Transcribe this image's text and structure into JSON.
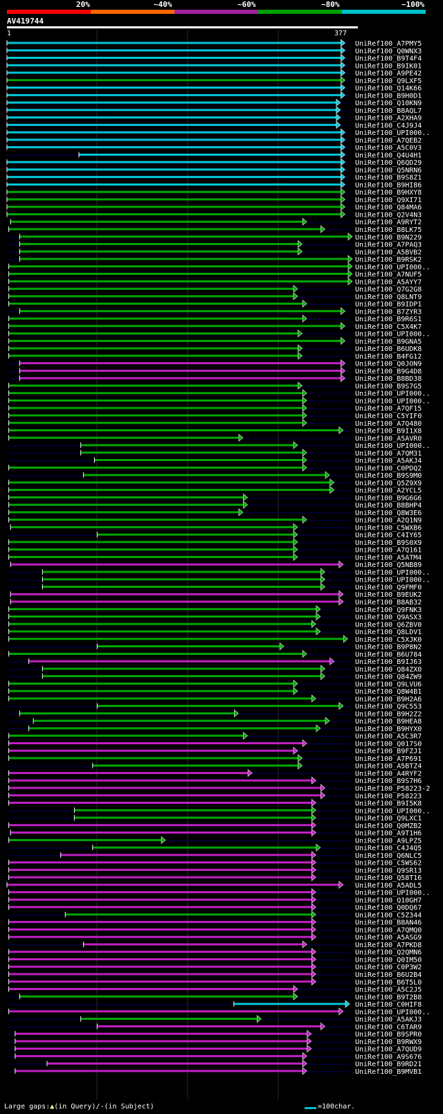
{
  "legend": [
    {
      "label": "20%",
      "color": "#ff0000"
    },
    {
      "label": "~40%",
      "color": "#ff6600"
    },
    {
      "label": "~60%",
      "color": "#a020a0"
    },
    {
      "label": "~80%",
      "color": "#00a000"
    },
    {
      "label": "~100%",
      "color": "#00c0c8"
    }
  ],
  "query_title": "AV419744",
  "query_length": 377,
  "ruler_start": "1",
  "ruler_end": "377",
  "footer": {
    "large_gaps": "Large gaps:",
    "in_query": "(in Query)/-",
    "in_subject": "(in Subject)",
    "scale_label": "=100char."
  },
  "hits": [
    {
      "name": "UniRef100_A7PMY5",
      "color": "cyan",
      "start": 1,
      "end": 372
    },
    {
      "name": "UniRef100_Q0WNX3",
      "color": "cyan",
      "start": 1,
      "end": 372
    },
    {
      "name": "UniRef100_B9T4F4",
      "color": "cyan",
      "start": 1,
      "end": 372
    },
    {
      "name": "UniRef100_B9IK01",
      "color": "cyan",
      "start": 1,
      "end": 372
    },
    {
      "name": "UniRef100_A9PE42",
      "color": "cyan",
      "start": 1,
      "end": 372
    },
    {
      "name": "UniRef100_Q9LXF5",
      "color": "green",
      "start": 1,
      "end": 372
    },
    {
      "name": "UniRef100_Q14K66",
      "color": "cyan",
      "start": 1,
      "end": 372
    },
    {
      "name": "UniRef100_B9H0D1",
      "color": "cyan",
      "start": 1,
      "end": 372
    },
    {
      "name": "UniRef100_Q10KN9",
      "color": "cyan",
      "start": 1,
      "end": 367
    },
    {
      "name": "UniRef100_B8AQL7",
      "color": "cyan",
      "start": 1,
      "end": 367
    },
    {
      "name": "UniRef100_A2XHA9",
      "color": "cyan",
      "start": 1,
      "end": 367
    },
    {
      "name": "UniRef100_C4J9J4",
      "color": "cyan",
      "start": 1,
      "end": 367
    },
    {
      "name": "UniRef100_UPI000..",
      "color": "cyan",
      "start": 1,
      "end": 372
    },
    {
      "name": "UniRef100_A7QEB2",
      "color": "cyan",
      "start": 1,
      "end": 372
    },
    {
      "name": "UniRef100_A5C0V3",
      "color": "cyan",
      "start": 1,
      "end": 372
    },
    {
      "name": "UniRef100_Q4U4H1",
      "color": "cyan",
      "start": 80,
      "end": 372
    },
    {
      "name": "UniRef100_Q6QD29",
      "color": "cyan",
      "start": 1,
      "end": 372
    },
    {
      "name": "UniRef100_Q5NRN6",
      "color": "cyan",
      "start": 1,
      "end": 372
    },
    {
      "name": "UniRef100_B9S8Z1",
      "color": "cyan",
      "start": 1,
      "end": 372
    },
    {
      "name": "UniRef100_B9HI86",
      "color": "cyan",
      "start": 1,
      "end": 372
    },
    {
      "name": "UniRef100_B9HXY8",
      "color": "green",
      "start": 1,
      "end": 372
    },
    {
      "name": "UniRef100_Q9XI71",
      "color": "green",
      "start": 1,
      "end": 372
    },
    {
      "name": "UniRef100_Q84MA6",
      "color": "green",
      "start": 1,
      "end": 372
    },
    {
      "name": "UniRef100_Q2V4N3",
      "color": "green",
      "start": 1,
      "end": 372
    },
    {
      "name": "UniRef100_A9RYT2",
      "color": "green",
      "start": 5,
      "end": 330
    },
    {
      "name": "UniRef100_B8LK75",
      "color": "green",
      "start": 3,
      "end": 350
    },
    {
      "name": "UniRef100_B9N229",
      "color": "green",
      "start": 15,
      "end": 380
    },
    {
      "name": "UniRef100_A7PAQ3",
      "color": "green",
      "start": 15,
      "end": 325
    },
    {
      "name": "UniRef100_A5BVB2",
      "color": "green",
      "start": 15,
      "end": 325
    },
    {
      "name": "UniRef100_B9RSK2",
      "color": "green",
      "start": 15,
      "end": 380
    },
    {
      "name": "UniRef100_UPI000..",
      "color": "green",
      "start": 3,
      "end": 380
    },
    {
      "name": "UniRef100_A7NUF5",
      "color": "green",
      "start": 3,
      "end": 380
    },
    {
      "name": "UniRef100_A5AYY7",
      "color": "green",
      "start": 3,
      "end": 380
    },
    {
      "name": "UniRef100_Q7G2G8",
      "color": "green",
      "start": 3,
      "end": 320
    },
    {
      "name": "UniRef100_Q8LNT9",
      "color": "green",
      "start": 3,
      "end": 320
    },
    {
      "name": "UniRef100_B9IDP1",
      "color": "green",
      "start": 3,
      "end": 330
    },
    {
      "name": "UniRef100_B7ZYR3",
      "color": "green",
      "start": 15,
      "end": 372
    },
    {
      "name": "UniRef100_B9R6S1",
      "color": "green",
      "start": 3,
      "end": 330
    },
    {
      "name": "UniRef100_C5X4K7",
      "color": "green",
      "start": 3,
      "end": 372
    },
    {
      "name": "UniRef100_UPI000..",
      "color": "green",
      "start": 3,
      "end": 325
    },
    {
      "name": "UniRef100_B9GNA5",
      "color": "green",
      "start": 3,
      "end": 372
    },
    {
      "name": "UniRef100_B6UDK8",
      "color": "green",
      "start": 3,
      "end": 325
    },
    {
      "name": "UniRef100_B4FG12",
      "color": "green",
      "start": 3,
      "end": 325
    },
    {
      "name": "UniRef100_Q0JON9",
      "color": "purple",
      "start": 15,
      "end": 372
    },
    {
      "name": "UniRef100_B9G4D8",
      "color": "purple",
      "start": 15,
      "end": 372
    },
    {
      "name": "UniRef100_B8BD38",
      "color": "purple",
      "start": 15,
      "end": 372
    },
    {
      "name": "UniRef100_B9S7G5",
      "color": "green",
      "start": 3,
      "end": 325
    },
    {
      "name": "UniRef100_UPI000..",
      "color": "green",
      "start": 3,
      "end": 330
    },
    {
      "name": "UniRef100_UPI000..",
      "color": "green",
      "start": 3,
      "end": 330
    },
    {
      "name": "UniRef100_A7QF15",
      "color": "green",
      "start": 3,
      "end": 330
    },
    {
      "name": "UniRef100_C5YIF0",
      "color": "green",
      "start": 3,
      "end": 330
    },
    {
      "name": "UniRef100_A7Q480",
      "color": "green",
      "start": 3,
      "end": 330
    },
    {
      "name": "UniRef100_B9I1X8",
      "color": "green",
      "start": 3,
      "end": 370
    },
    {
      "name": "UniRef100_A5AVR0",
      "color": "green",
      "start": 3,
      "end": 260
    },
    {
      "name": "UniRef100_UPI000..",
      "color": "green",
      "start": 82,
      "end": 320
    },
    {
      "name": "UniRef100_A7QM31",
      "color": "green",
      "start": 82,
      "end": 330
    },
    {
      "name": "UniRef100_A5AKJ4",
      "color": "green",
      "start": 97,
      "end": 330
    },
    {
      "name": "UniRef100_C0PDQ2",
      "color": "green",
      "start": 3,
      "end": 330
    },
    {
      "name": "UniRef100_B9S9M0",
      "color": "green",
      "start": 85,
      "end": 355
    },
    {
      "name": "UniRef100_Q5Z9X9",
      "color": "green",
      "start": 3,
      "end": 360
    },
    {
      "name": "UniRef100_A2YCL5",
      "color": "green",
      "start": 3,
      "end": 360
    },
    {
      "name": "UniRef100_B9G6G6",
      "color": "green",
      "start": 3,
      "end": 265
    },
    {
      "name": "UniRef100_B8BHP4",
      "color": "green",
      "start": 3,
      "end": 265
    },
    {
      "name": "UniRef100_Q8W3E6",
      "color": "green",
      "start": 3,
      "end": 260
    },
    {
      "name": "UniRef100_A2Q1N9",
      "color": "green",
      "start": 3,
      "end": 330
    },
    {
      "name": "UniRef100_C5WXB6",
      "color": "green",
      "start": 5,
      "end": 320
    },
    {
      "name": "UniRef100_C4IY65",
      "color": "green",
      "start": 100,
      "end": 320
    },
    {
      "name": "UniRef100_B9S0X9",
      "color": "green",
      "start": 3,
      "end": 320
    },
    {
      "name": "UniRef100_A7Q161",
      "color": "green",
      "start": 3,
      "end": 320
    },
    {
      "name": "UniRef100_A5ATM4",
      "color": "green",
      "start": 3,
      "end": 320
    },
    {
      "name": "UniRef100_Q5NB89",
      "color": "purple",
      "start": 5,
      "end": 370
    },
    {
      "name": "UniRef100_UPI000..",
      "color": "green",
      "start": 40,
      "end": 350
    },
    {
      "name": "UniRef100_UPI000..",
      "color": "green",
      "start": 40,
      "end": 350
    },
    {
      "name": "UniRef100_Q9FMF0",
      "color": "green",
      "start": 40,
      "end": 350
    },
    {
      "name": "UniRef100_B9EUK2",
      "color": "purple",
      "start": 5,
      "end": 370
    },
    {
      "name": "UniRef100_B8AB32",
      "color": "purple",
      "start": 5,
      "end": 370
    },
    {
      "name": "UniRef100_Q9FNK3",
      "color": "green",
      "start": 3,
      "end": 345
    },
    {
      "name": "UniRef100_Q9ASX3",
      "color": "green",
      "start": 3,
      "end": 345
    },
    {
      "name": "UniRef100_Q6ZBV0",
      "color": "green",
      "start": 3,
      "end": 340
    },
    {
      "name": "UniRef100_Q8LDV1",
      "color": "green",
      "start": 3,
      "end": 345
    },
    {
      "name": "UniRef100_C5XJK0",
      "color": "green",
      "start": 3,
      "end": 375
    },
    {
      "name": "UniRef100_B9P8N2",
      "color": "green",
      "start": 100,
      "end": 305
    },
    {
      "name": "UniRef100_B6U784",
      "color": "green",
      "start": 3,
      "end": 330
    },
    {
      "name": "UniRef100_B9IJ63",
      "color": "purple",
      "start": 25,
      "end": 360
    },
    {
      "name": "UniRef100_Q84ZX0",
      "color": "green",
      "start": 40,
      "end": 350
    },
    {
      "name": "UniRef100_Q84ZW9",
      "color": "green",
      "start": 40,
      "end": 350
    },
    {
      "name": "UniRef100_Q9LVU6",
      "color": "green",
      "start": 3,
      "end": 320
    },
    {
      "name": "UniRef100_Q8W4B1",
      "color": "green",
      "start": 3,
      "end": 320
    },
    {
      "name": "UniRef100_B9H2A6",
      "color": "green",
      "start": 3,
      "end": 340
    },
    {
      "name": "UniRef100_Q9C553",
      "color": "green",
      "start": 100,
      "end": 370
    },
    {
      "name": "UniRef100_B9H2Z2",
      "color": "green",
      "start": 15,
      "end": 255
    },
    {
      "name": "UniRef100_B9HEA8",
      "color": "green",
      "start": 30,
      "end": 355
    },
    {
      "name": "UniRef100_B9HYX0",
      "color": "green",
      "start": 25,
      "end": 345
    },
    {
      "name": "UniRef100_A5C3R7",
      "color": "green",
      "start": 3,
      "end": 265
    },
    {
      "name": "UniRef100_Q017S0",
      "color": "purple",
      "start": 3,
      "end": 330
    },
    {
      "name": "UniRef100_B9FZJ1",
      "color": "purple",
      "start": 3,
      "end": 320
    },
    {
      "name": "UniRef100_A7P691",
      "color": "green",
      "start": 3,
      "end": 325
    },
    {
      "name": "UniRef100_A5BTZ4",
      "color": "green",
      "start": 95,
      "end": 325
    },
    {
      "name": "UniRef100_A4RYF2",
      "color": "purple",
      "start": 3,
      "end": 270
    },
    {
      "name": "UniRef100_B9S7H6",
      "color": "purple",
      "start": 3,
      "end": 340
    },
    {
      "name": "UniRef100_P58223-2",
      "color": "purple",
      "start": 3,
      "end": 350
    },
    {
      "name": "UniRef100_P58223",
      "color": "purple",
      "start": 3,
      "end": 350
    },
    {
      "name": "UniRef100_B9I5K8",
      "color": "purple",
      "start": 3,
      "end": 340
    },
    {
      "name": "UniRef100_UPI000..",
      "color": "green",
      "start": 75,
      "end": 340
    },
    {
      "name": "UniRef100_Q9LXC1",
      "color": "green",
      "start": 75,
      "end": 340
    },
    {
      "name": "UniRef100_Q0MZB2",
      "color": "purple",
      "start": 3,
      "end": 340
    },
    {
      "name": "UniRef100_A9T1H6",
      "color": "purple",
      "start": 5,
      "end": 340
    },
    {
      "name": "UniRef100_A9LPZ5",
      "color": "green",
      "start": 3,
      "end": 175
    },
    {
      "name": "UniRef100_C4J4Q5",
      "color": "green",
      "start": 95,
      "end": 345
    },
    {
      "name": "UniRef100_Q6NLC5",
      "color": "purple",
      "start": 60,
      "end": 340
    },
    {
      "name": "UniRef100_C5WS62",
      "color": "purple",
      "start": 3,
      "end": 340
    },
    {
      "name": "UniRef100_Q9SR13",
      "color": "purple",
      "start": 3,
      "end": 340
    },
    {
      "name": "UniRef100_Q58T16",
      "color": "purple",
      "start": 3,
      "end": 340
    },
    {
      "name": "UniRef100_A5ADL5",
      "color": "purple",
      "start": 1,
      "end": 370
    },
    {
      "name": "UniRef100_UPI000..",
      "color": "purple",
      "start": 3,
      "end": 340
    },
    {
      "name": "UniRef100_Q10GH7",
      "color": "purple",
      "start": 3,
      "end": 340
    },
    {
      "name": "UniRef100_Q0DQ67",
      "color": "purple",
      "start": 3,
      "end": 340
    },
    {
      "name": "UniRef100_C5Z344",
      "color": "green",
      "start": 65,
      "end": 340
    },
    {
      "name": "UniRef100_B8AN46",
      "color": "purple",
      "start": 3,
      "end": 340
    },
    {
      "name": "UniRef100_A7QMQ0",
      "color": "purple",
      "start": 3,
      "end": 340
    },
    {
      "name": "UniRef100_A5ASG9",
      "color": "purple",
      "start": 3,
      "end": 340
    },
    {
      "name": "UniRef100_A7PKD8",
      "color": "purple",
      "start": 85,
      "end": 330
    },
    {
      "name": "UniRef100_Q2QMN6",
      "color": "purple",
      "start": 3,
      "end": 340
    },
    {
      "name": "UniRef100_Q0IM50",
      "color": "purple",
      "start": 3,
      "end": 340
    },
    {
      "name": "UniRef100_C0P3W2",
      "color": "purple",
      "start": 3,
      "end": 340
    },
    {
      "name": "UniRef100_B6U2B4",
      "color": "purple",
      "start": 3,
      "end": 340
    },
    {
      "name": "UniRef100_B6T5L0",
      "color": "purple",
      "start": 3,
      "end": 340
    },
    {
      "name": "UniRef100_A5C2J5",
      "color": "purple",
      "start": 3,
      "end": 320
    },
    {
      "name": "UniRef100_B9T2B8",
      "color": "green",
      "start": 15,
      "end": 320
    },
    {
      "name": "UniRef100_C0HIF8",
      "color": "cyan",
      "start": 250,
      "end": 377
    },
    {
      "name": "UniRef100_UPI000..",
      "color": "purple",
      "start": 3,
      "end": 370
    },
    {
      "name": "UniRef100_A5AKJ3",
      "color": "green",
      "start": 82,
      "end": 280
    },
    {
      "name": "UniRef100_C6TAR9",
      "color": "purple",
      "start": 100,
      "end": 350
    },
    {
      "name": "UniRef100_B9SPR0",
      "color": "purple",
      "start": 10,
      "end": 335
    },
    {
      "name": "UniRef100_B9RWX9",
      "color": "purple",
      "start": 10,
      "end": 335
    },
    {
      "name": "UniRef100_A7QUD9",
      "color": "purple",
      "start": 10,
      "end": 335
    },
    {
      "name": "UniRef100_A9S676",
      "color": "purple",
      "start": 10,
      "end": 330
    },
    {
      "name": "UniRef100_B9RD21",
      "color": "purple",
      "start": 45,
      "end": 330
    },
    {
      "name": "UniRef100_B9MVB1",
      "color": "purple",
      "start": 10,
      "end": 330
    }
  ]
}
